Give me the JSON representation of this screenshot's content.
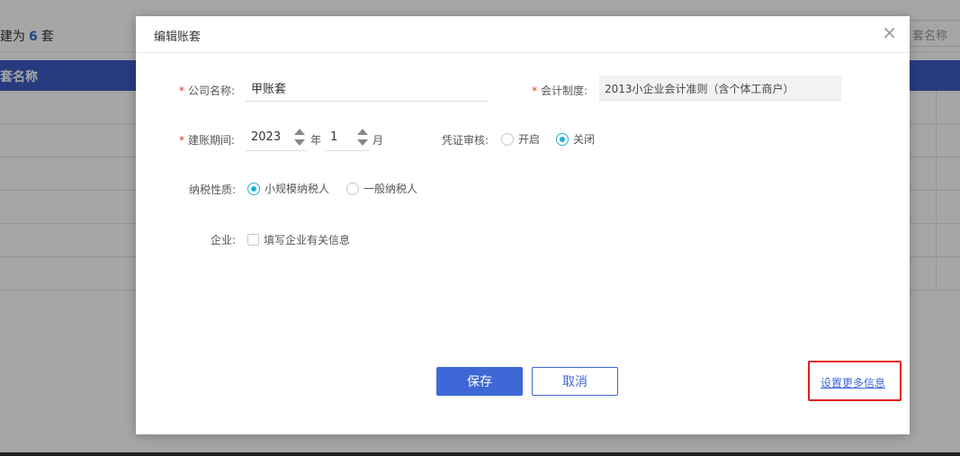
{
  "background": {
    "count_prefix": "建为",
    "count_value": "6",
    "count_suffix": "套",
    "search_placeholder": "套名称",
    "table_header": "套名称"
  },
  "modal": {
    "title": "编辑账套",
    "close_label": "×",
    "company_name": {
      "required_mark": "*",
      "label": "公司名称:",
      "value": "甲账套"
    },
    "accounting_system": {
      "required_mark": "*",
      "label": "会计制度:",
      "value": "2013小企业会计准则（含个体工商户）"
    },
    "period": {
      "required_mark": "*",
      "label": "建账期间:",
      "year": "2023",
      "year_unit": "年",
      "month": "1",
      "month_unit": "月"
    },
    "voucher_review": {
      "label": "凭证审核:",
      "options": [
        "开启",
        "关闭"
      ],
      "selected": "关闭"
    },
    "tax_nature": {
      "label": "纳税性质:",
      "options": [
        "小规模纳税人",
        "一般纳税人"
      ],
      "selected": "小规模纳税人"
    },
    "enterprise": {
      "label": "企业:",
      "checkbox_label": "填写企业有关信息",
      "checked": false
    },
    "save_label": "保存",
    "cancel_label": "取消",
    "more_info_label": "设置更多信息"
  },
  "colors": {
    "primary": "#3d68d6",
    "radio_accent": "#21b0d4",
    "required": "#e0322c",
    "highlight_border": "#e02020"
  }
}
